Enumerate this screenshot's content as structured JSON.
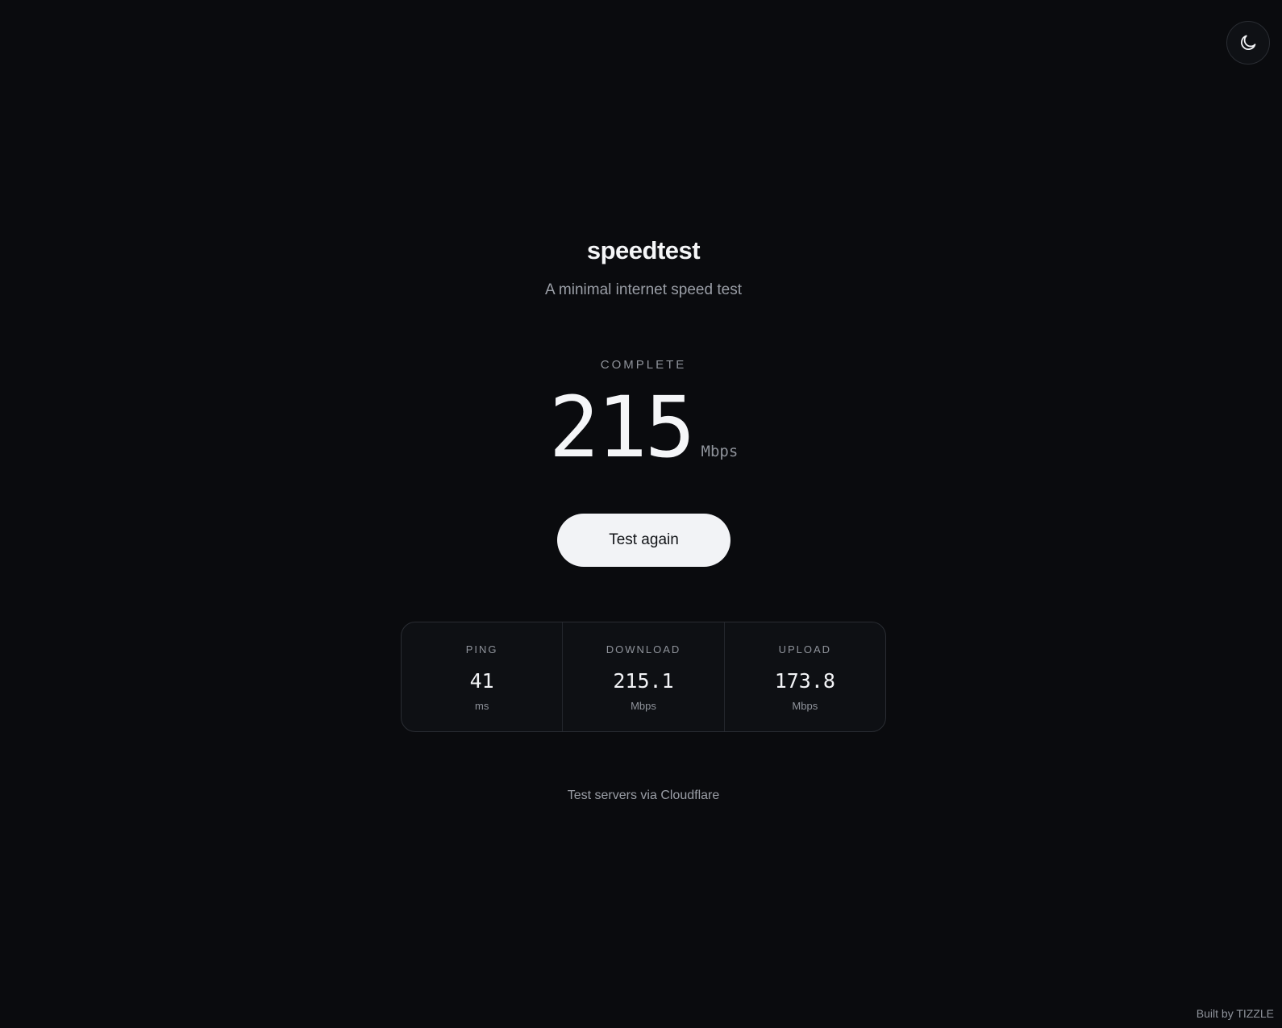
{
  "theme_toggle": {
    "icon": "moon-icon"
  },
  "header": {
    "title": "speedtest",
    "subtitle": "A minimal internet speed test"
  },
  "status": {
    "label": "COMPLETE",
    "value": "215",
    "unit": "Mbps"
  },
  "actions": {
    "test_again_label": "Test again"
  },
  "results": {
    "ping": {
      "label": "PING",
      "value": "41",
      "unit": "ms"
    },
    "download": {
      "label": "DOWNLOAD",
      "value": "215.1",
      "unit": "Mbps"
    },
    "upload": {
      "label": "UPLOAD",
      "value": "173.8",
      "unit": "Mbps"
    }
  },
  "footer": {
    "server_note": "Test servers via Cloudflare",
    "credit": "Built by TIZZLE"
  },
  "colors": {
    "background": "#0a0b0e",
    "panel": "#0e1014",
    "border": "#2a2d33",
    "text_primary": "#f2f3f6",
    "text_muted": "#8f939b",
    "button_bg": "#f2f3f6",
    "button_text": "#111317"
  }
}
